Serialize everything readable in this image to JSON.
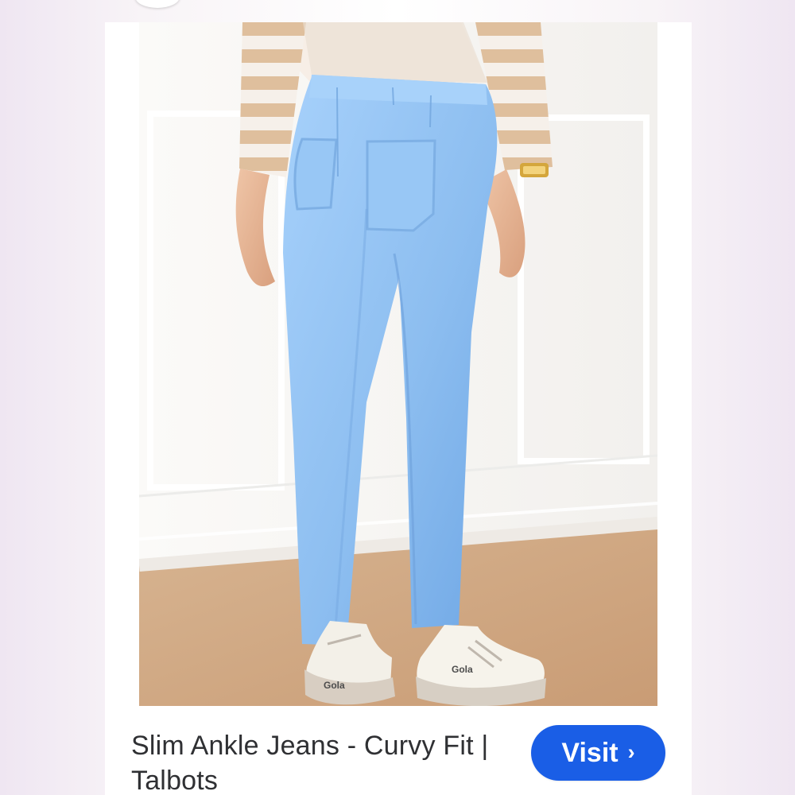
{
  "result_card": {
    "title": "Slim Ankle Jeans - Curvy Fit | Talbots",
    "visit_label": "Visit",
    "visit_icon": "chevron-right-icon"
  },
  "image": {
    "brand_text": "Gola",
    "subject": "light blue slim ankle jeans with white sneakers"
  },
  "colors": {
    "accent": "#1a5ee6",
    "jeans": "#8fc0f2",
    "background": "#ffffff"
  }
}
